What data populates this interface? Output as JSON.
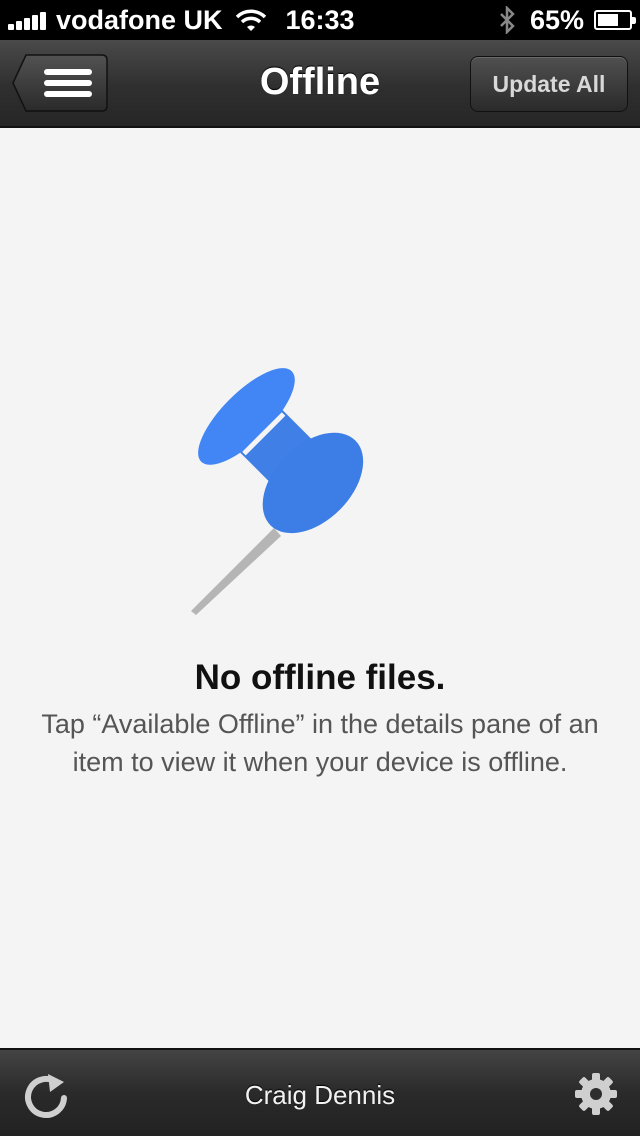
{
  "status_bar": {
    "carrier": "vodafone UK",
    "time": "16:33",
    "battery_percent": "65%",
    "battery_level": 0.65,
    "icons": [
      "signal-icon",
      "wifi-icon",
      "bluetooth-icon",
      "battery-icon"
    ]
  },
  "nav_bar": {
    "title": "Offline",
    "update_all_label": "Update All",
    "menu_icon": "menu-icon"
  },
  "empty_state": {
    "icon": "pushpin-icon",
    "title": "No offline files.",
    "message": "Tap “Available Offline” in the details pane of an item to view it when your device is offline."
  },
  "toolbar": {
    "account_name": "Craig Dennis",
    "refresh_icon": "refresh-icon",
    "settings_icon": "gear-icon"
  },
  "colors": {
    "accent": "#4285f4",
    "background": "#f4f4f4"
  }
}
